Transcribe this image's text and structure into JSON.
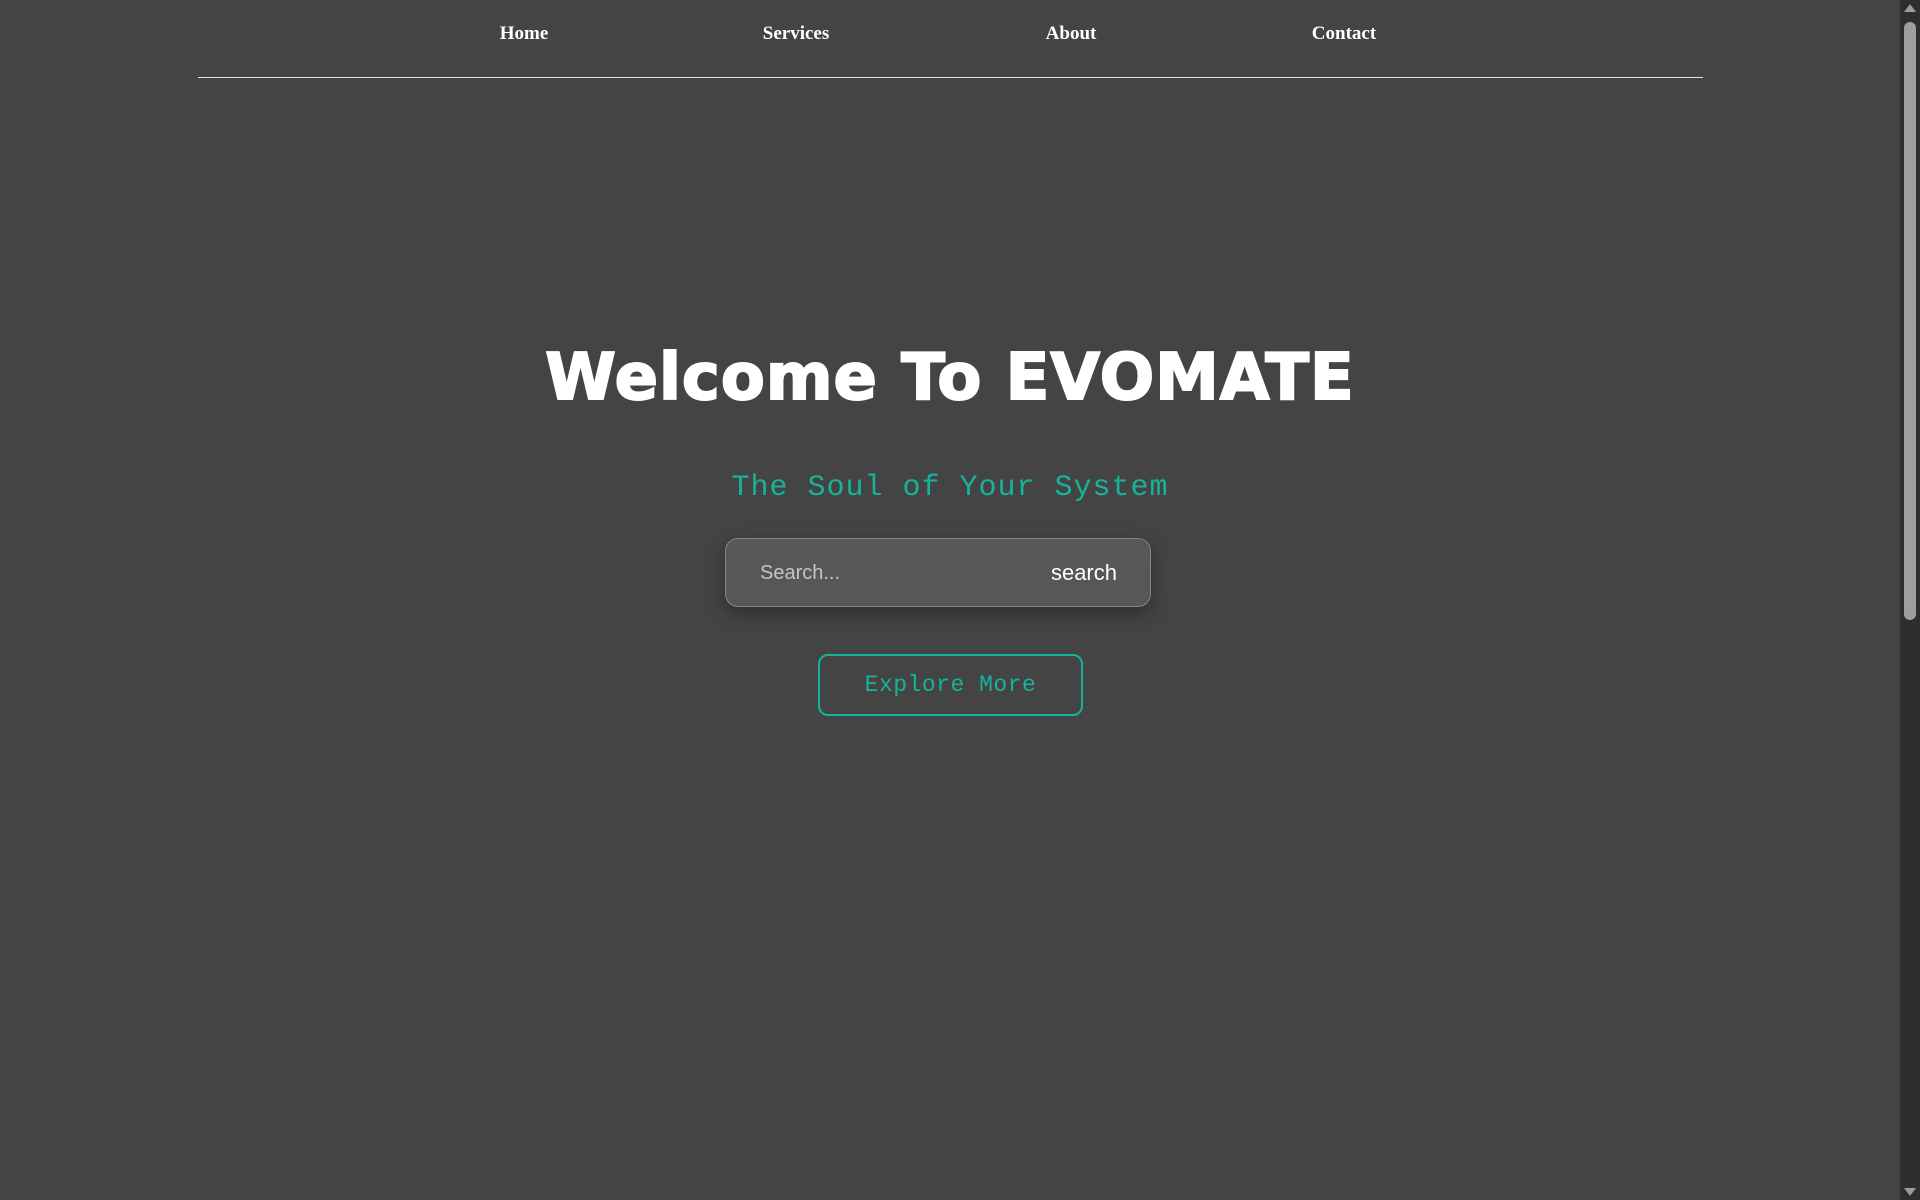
{
  "nav": {
    "items": [
      {
        "label": "Home"
      },
      {
        "label": "Services"
      },
      {
        "label": "About"
      },
      {
        "label": "Contact"
      }
    ]
  },
  "hero": {
    "title": "Welcome To EVOMATE",
    "subtitle": "The Soul of Your System"
  },
  "search": {
    "placeholder": "Search...",
    "value": "",
    "button_label": "search"
  },
  "explore": {
    "label": "Explore More"
  },
  "colors": {
    "background": "#444444",
    "accent": "#16b39a",
    "text": "#ffffff"
  }
}
